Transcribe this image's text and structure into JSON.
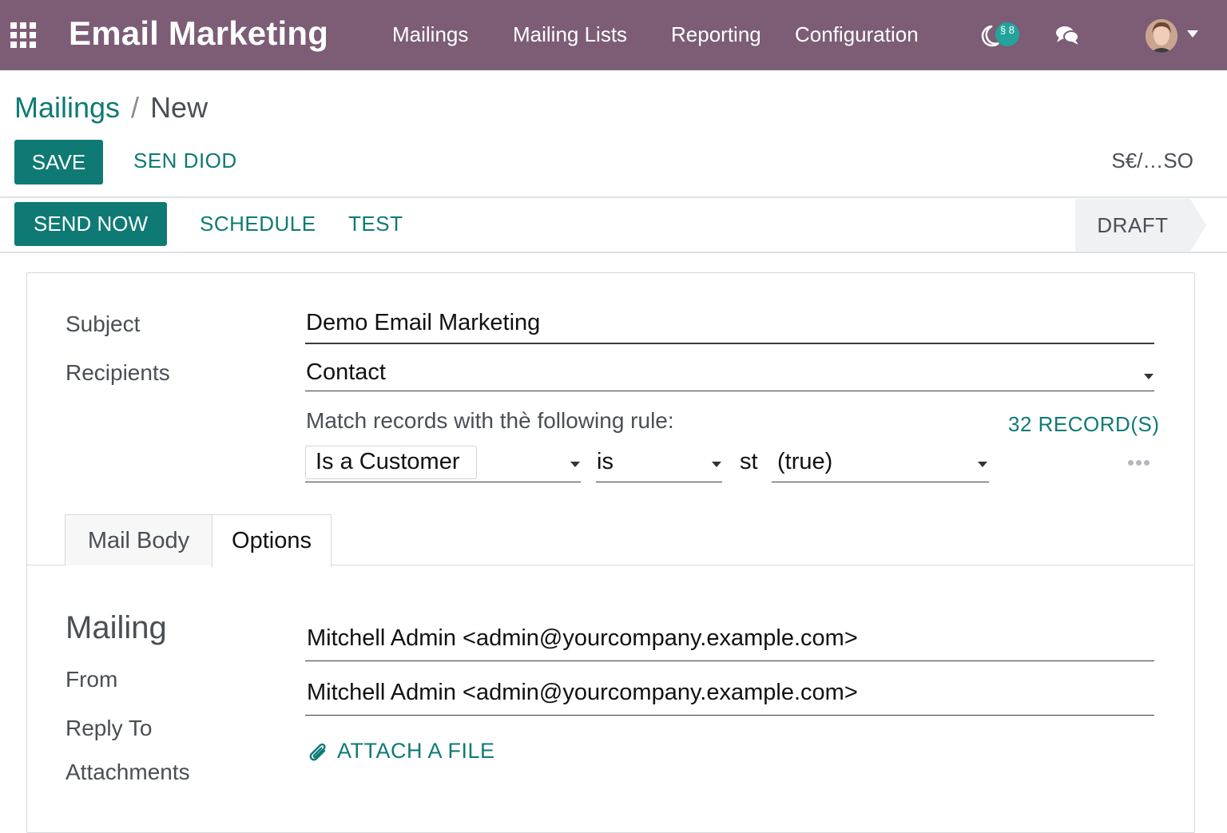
{
  "navbar": {
    "brand": "Email Marketing",
    "menu": [
      "Mailings",
      "Mailing Lists",
      "Reporting",
      "Configuration"
    ],
    "activity_badge": "§ 8",
    "color": "#7c5d75"
  },
  "breadcrumb": {
    "parent": "Mailings",
    "separator": "/",
    "current": "New"
  },
  "actions": {
    "save_label": "SAVE",
    "secondary_label": "SEN DIOD",
    "pager_text": "S€/…SO"
  },
  "statusbar": {
    "send_now_label": "SEND NOW",
    "schedule_label": "SCHEDULE",
    "test_label": "TEST",
    "state": "DRAFT"
  },
  "form": {
    "subject_label": "Subject",
    "subject_value": "Demo Email Marketing",
    "recipients_label": "Recipients",
    "recipients_value": "Contact",
    "rule_text": "Match records with thè following rule:",
    "records_count": "32 RECORD(S)",
    "rule": {
      "field": "Is a Customer",
      "operator": "is",
      "prefix": "st",
      "value": "(true)"
    }
  },
  "tabs": [
    "Mail Body",
    "Options"
  ],
  "active_tab": "Options",
  "options": {
    "section_title": "Mailing",
    "from_label": "From",
    "from_value": "Mitchell Admin <admin@yourcompany.example.com>",
    "reply_to_label": "Reply To",
    "reply_to_value": "Mitchell Admin <admin@yourcompany.example.com>",
    "attachments_label": "Attachments",
    "attach_file_label": "ATTACH A FILE"
  },
  "colors": {
    "primary": "#0f7a74",
    "navbar": "#7c5d75",
    "badge": "#23a39b"
  },
  "icons": [
    "apps-grid-icon",
    "moon-icon",
    "chat-icon",
    "caret-down-icon",
    "paperclip-icon",
    "ellipsis-icon"
  ]
}
